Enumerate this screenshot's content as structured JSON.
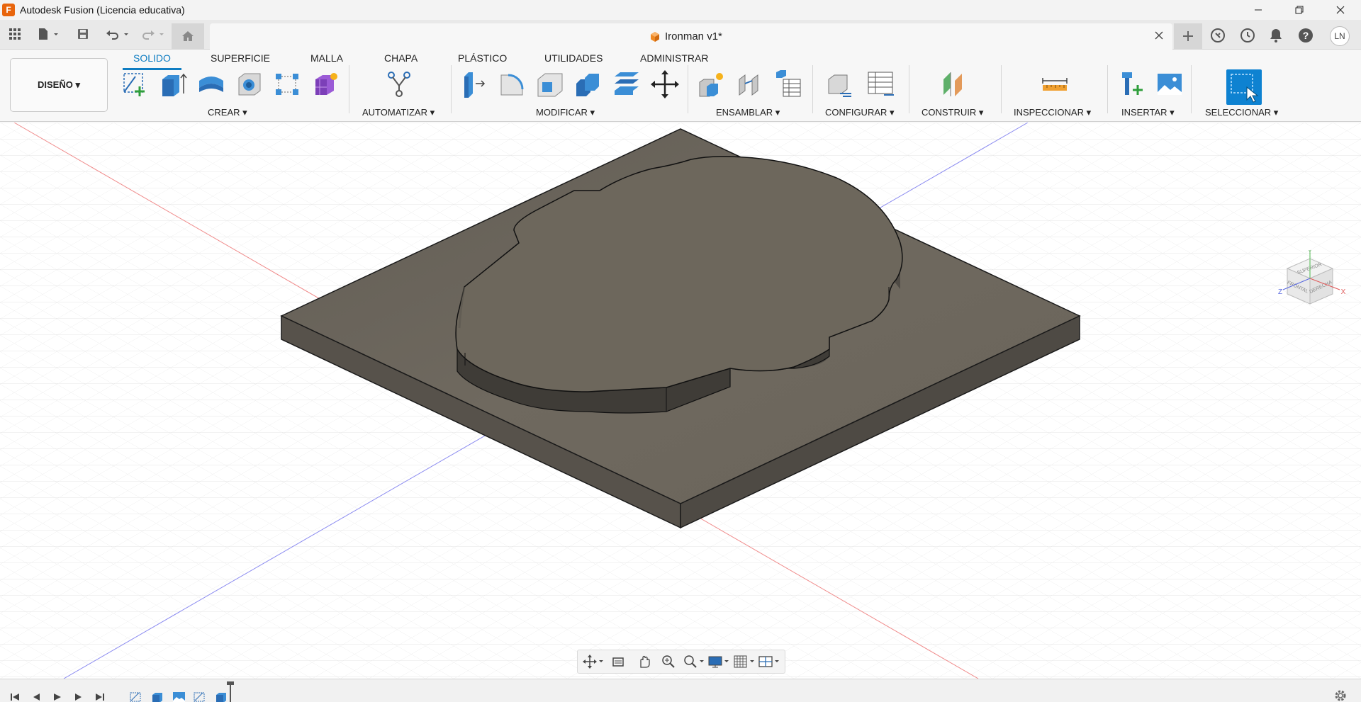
{
  "window": {
    "title": "Autodesk Fusion (Licencia educativa)",
    "logo_letter": "F"
  },
  "document": {
    "tab_title": "Ironman v1*"
  },
  "user": {
    "initials": "LN"
  },
  "workspace": {
    "label": "DISEÑO ▾"
  },
  "ribbon_tabs": [
    "SOLIDO",
    "SUPERFICIE",
    "MALLA",
    "CHAPA",
    "PLÁSTICO",
    "UTILIDADES",
    "ADMINISTRAR"
  ],
  "ribbon_active_tab": "SOLIDO",
  "ribbon_groups": {
    "crear": "CREAR ▾",
    "automatizar": "AUTOMATIZAR ▾",
    "modificar": "MODIFICAR ▾",
    "ensamblar": "ENSAMBLAR ▾",
    "configurar": "CONFIGURAR ▾",
    "construir": "CONSTRUIR ▾",
    "inspeccionar": "INSPECCIONAR ▾",
    "insertar": "INSERTAR ▾",
    "seleccionar": "SELECCIONAR ▾"
  },
  "viewcube": {
    "face_top": "SUPERIOR",
    "face_front": "FRONTAL",
    "face_right": "DERECHA",
    "axis_x": "X",
    "axis_y": "Y",
    "axis_z": "Z"
  },
  "colors": {
    "accent": "#0f7dc2",
    "model_top": "#6d675c",
    "model_side": "#57534c",
    "grid": "#dcdcdc",
    "axis_red": "#f08080",
    "axis_blue": "#8080f0"
  }
}
